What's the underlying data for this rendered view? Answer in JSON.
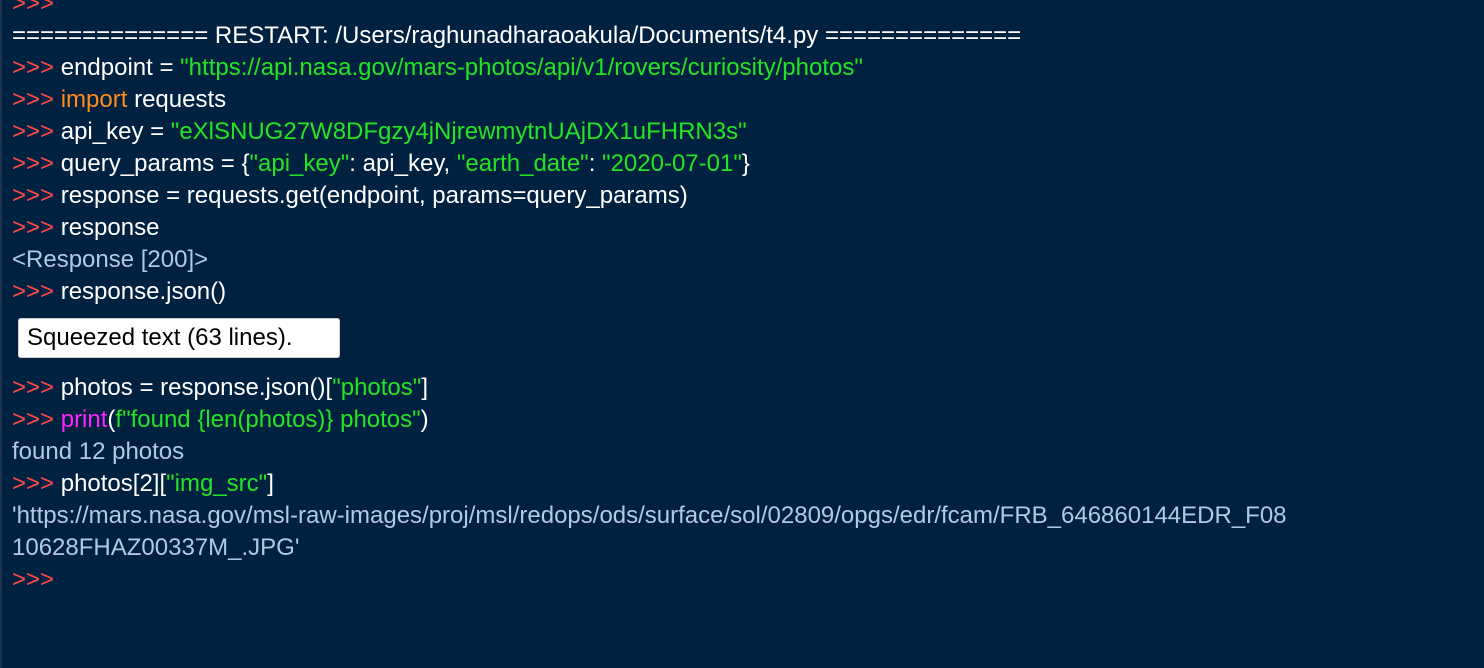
{
  "colors": {
    "background": "#002240",
    "prompt": "#ff4a4a",
    "string": "#24e324",
    "keyword": "#ff8a1c",
    "builtin": "#ff22ff",
    "output": "#b2c8e6",
    "text": "#ffffff"
  },
  "shell": {
    "prompt": ">>>",
    "restart_banner": "============== RESTART: /Users/raghunadharaoakula/Documents/t4.py ==============",
    "lines": {
      "endpoint": {
        "code": " endpoint = ",
        "string": "\"https://api.nasa.gov/mars-photos/api/v1/rovers/curiosity/photos\""
      },
      "import": {
        "keyword": " import",
        "code": " requests"
      },
      "api_key": {
        "code": " api_key = ",
        "string": "\"eXlSNUG27W8DFgzy4jNjrewmytnUAjDX1uFHRN3s\""
      },
      "query_params": {
        "code_open": " query_params = {",
        "key1": "\"api_key\"",
        "mid1": ": api_key, ",
        "key2": "\"earth_date\"",
        "mid2": ": ",
        "value2": "\"2020-07-01\"",
        "code_close": "}"
      },
      "response_get": {
        "code": " response = requests.get(endpoint, params=query_params)"
      },
      "response": {
        "code": " response"
      },
      "response_output": "<Response [200]>",
      "response_json": {
        "code": " response.json()"
      },
      "squeezed_text": "Squeezed text (63 lines).",
      "photos_assign": {
        "code_open": " photos = response.json()[",
        "string": "\"photos\"",
        "code_close": "]"
      },
      "print_call": {
        "space": " ",
        "builtin": "print",
        "open": "(",
        "string": "f\"found {len(photos)} photos\"",
        "close": ")"
      },
      "print_output": "found 12 photos",
      "img_src": {
        "code_open": " photos[2][",
        "string": "\"img_src\"",
        "code_close": "]"
      },
      "img_src_output_1": "'https://mars.nasa.gov/msl-raw-images/proj/msl/redops/ods/surface/sol/02809/opgs/edr/fcam/FRB_646860144EDR_F08",
      "img_src_output_2": "10628FHAZ00337M_.JPG'"
    }
  }
}
